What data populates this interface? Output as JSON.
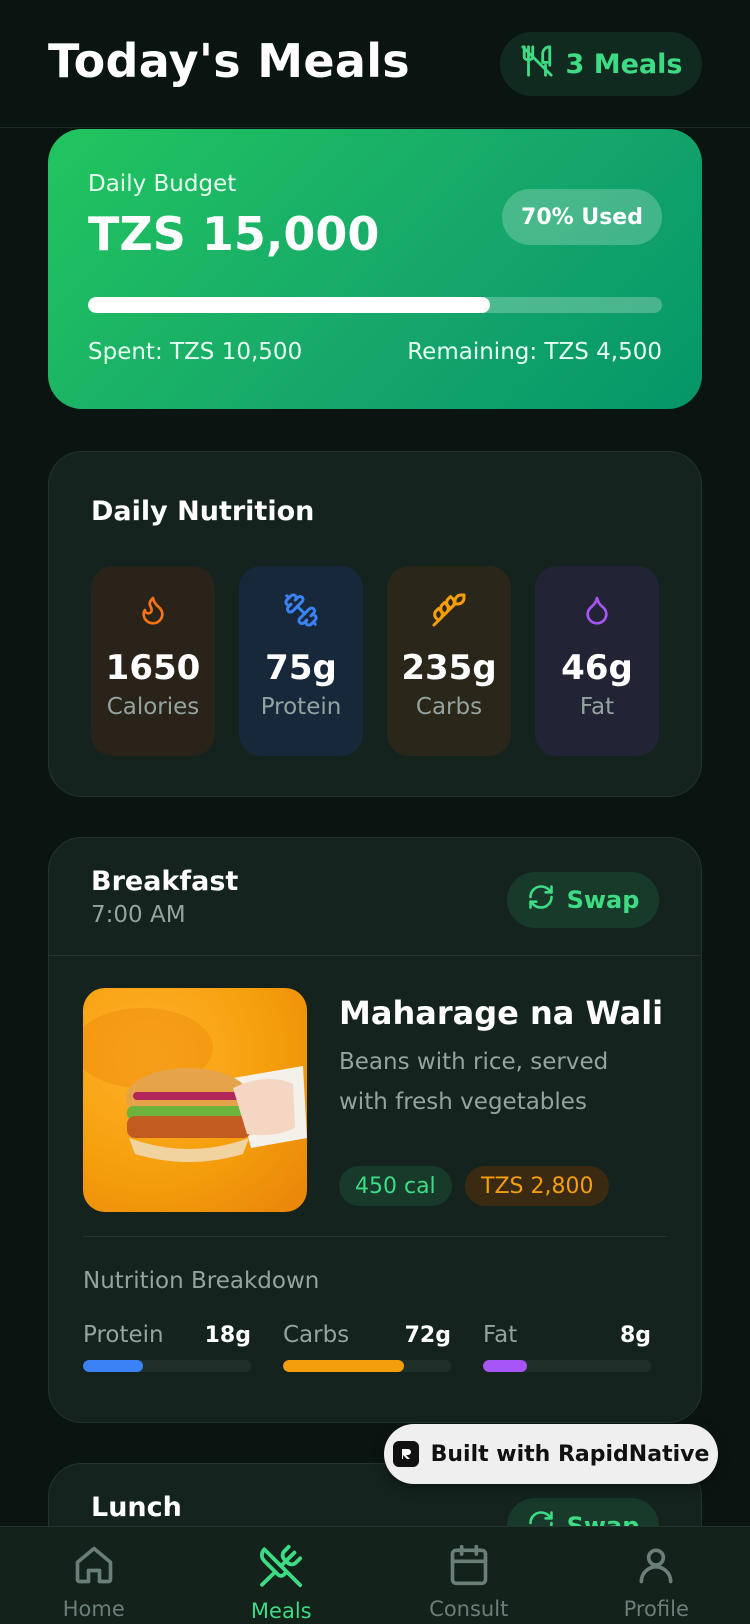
{
  "header": {
    "title": "Today's Meals",
    "meals_badge": "3 Meals"
  },
  "budget": {
    "label": "Daily Budget",
    "amount": "TZS 15,000",
    "used_badge": "70% Used",
    "used_fraction": 0.7,
    "spent": "Spent: TZS 10,500",
    "remaining": "Remaining: TZS 4,500"
  },
  "nutrition": {
    "title": "Daily Nutrition",
    "tiles": [
      {
        "icon": "flame-icon",
        "value": "1650",
        "label": "Calories",
        "color": "#f97316",
        "bg": "#2a231a"
      },
      {
        "icon": "dumbbell-icon",
        "value": "75g",
        "label": "Protein",
        "color": "#3b82f6",
        "bg": "#16283a"
      },
      {
        "icon": "wheat-icon",
        "value": "235g",
        "label": "Carbs",
        "color": "#f59e0b",
        "bg": "#2a261a"
      },
      {
        "icon": "droplet-icon",
        "value": "46g",
        "label": "Fat",
        "color": "#a855f7",
        "bg": "#222436"
      }
    ]
  },
  "breakfast": {
    "name": "Breakfast",
    "time": "7:00 AM",
    "swap_label": "Swap",
    "dish_name": "Maharage na Wali",
    "dish_desc": "Beans with rice, served with fresh vegetables",
    "calories_tag": "450 cal",
    "price_tag": "TZS 2,800",
    "breakdown_title": "Nutrition Breakdown",
    "breakdown": [
      {
        "label": "Protein",
        "value": "18g",
        "fraction": 0.36,
        "color": "#3b82f6"
      },
      {
        "label": "Carbs",
        "value": "72g",
        "fraction": 0.72,
        "color": "#f59e0b"
      },
      {
        "label": "Fat",
        "value": "8g",
        "fraction": 0.26,
        "color": "#a855f7"
      }
    ]
  },
  "lunch": {
    "name": "Lunch",
    "swap_label": "Swap"
  },
  "badge": {
    "label": "Built with RapidNative"
  },
  "tabs": [
    {
      "label": "Home",
      "icon": "home-icon"
    },
    {
      "label": "Meals",
      "icon": "utensils-icon"
    },
    {
      "label": "Consult",
      "icon": "calendar-icon"
    },
    {
      "label": "Profile",
      "icon": "user-icon"
    }
  ],
  "colors": {
    "accent": "#3ddc84",
    "background": "#0a1512",
    "card": "#14231e"
  }
}
